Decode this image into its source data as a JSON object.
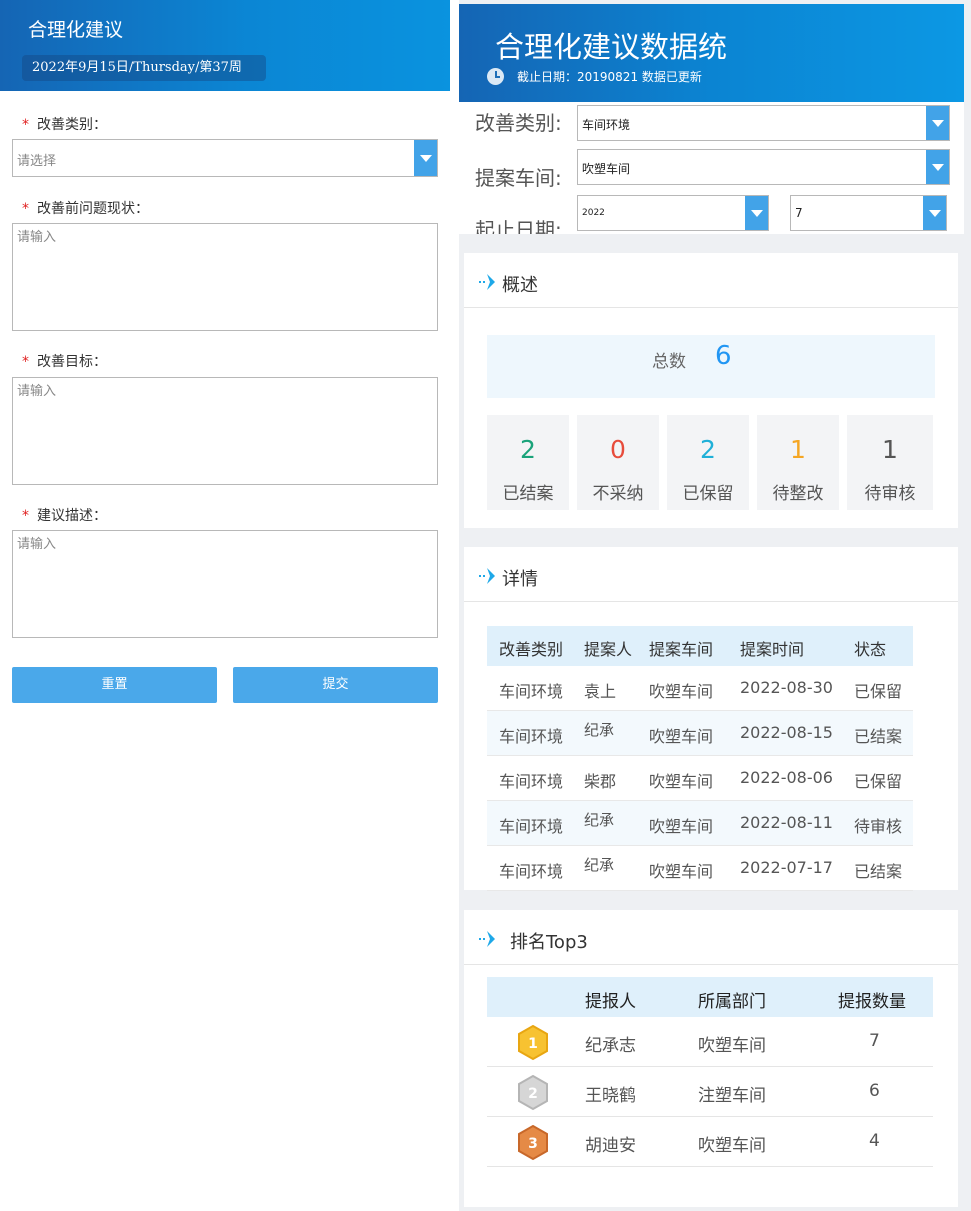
{
  "left": {
    "title": "合理化建议",
    "date": "2022年9月15日/Thursday/第37周",
    "fields": {
      "category": {
        "label": "改善类别：",
        "placeholder": "请选择"
      },
      "current": {
        "label": "改善前问题现状：",
        "placeholder": "请输入"
      },
      "target": {
        "label": "改善目标：",
        "placeholder": "请输入"
      },
      "description": {
        "label": "建议描述：",
        "placeholder": "请输入"
      }
    },
    "required_mark": "*",
    "reset_label": "重置",
    "submit_label": "提交"
  },
  "right": {
    "title": "合理化建议数据统",
    "subtitle": "截止日期：20190821 数据已更新",
    "filters": {
      "category_label": "改善类别:",
      "category_value": "车间环境",
      "workshop_label": "提案车间:",
      "workshop_value": "吹塑车间",
      "date_label": "起止日期:",
      "year_value": "2022",
      "month_value": "7"
    },
    "overview": {
      "title": "概述",
      "total_label": "总数",
      "total_value": "6",
      "stats": [
        {
          "value": "2",
          "label": "已结案",
          "color": "#1aa37a"
        },
        {
          "value": "0",
          "label": "不采纳",
          "color": "#e74c3c"
        },
        {
          "value": "2",
          "label": "已保留",
          "color": "#1fb0d8"
        },
        {
          "value": "1",
          "label": "待整改",
          "color": "#f5a623"
        },
        {
          "value": "1",
          "label": "待审核",
          "color": "#555555"
        }
      ]
    },
    "details": {
      "title": "详情",
      "headers": [
        "改善类别",
        "提案人",
        "提案车间",
        "提案时间",
        "状态"
      ],
      "rows": [
        [
          "车间环境",
          "袁上",
          "吹塑车间",
          "2022-08-30",
          "已保留"
        ],
        [
          "车间环境",
          "纪承",
          "吹塑车间",
          "2022-08-15",
          "已结案"
        ],
        [
          "车间环境",
          "柴郡",
          "吹塑车间",
          "2022-08-06",
          "已保留"
        ],
        [
          "车间环境",
          "纪承",
          "吹塑车间",
          "2022-08-11",
          "待审核"
        ],
        [
          "车间环境",
          "纪承",
          "吹塑车间",
          "2022-07-17",
          "已结案"
        ]
      ]
    },
    "ranking": {
      "title": "排名Top3",
      "headers": [
        "提报人",
        "所属部门",
        "提报数量"
      ],
      "rows": [
        {
          "medal": "gold-medal-icon",
          "rank": "1",
          "name": "纪承志",
          "dept": "吹塑车间",
          "count": "7"
        },
        {
          "medal": "silver-medal-icon",
          "rank": "2",
          "name": "王晓鹤",
          "dept": "注塑车间",
          "count": "6"
        },
        {
          "medal": "bronze-medal-icon",
          "rank": "3",
          "name": "胡迪安",
          "dept": "吹塑车间",
          "count": "4"
        }
      ]
    }
  }
}
